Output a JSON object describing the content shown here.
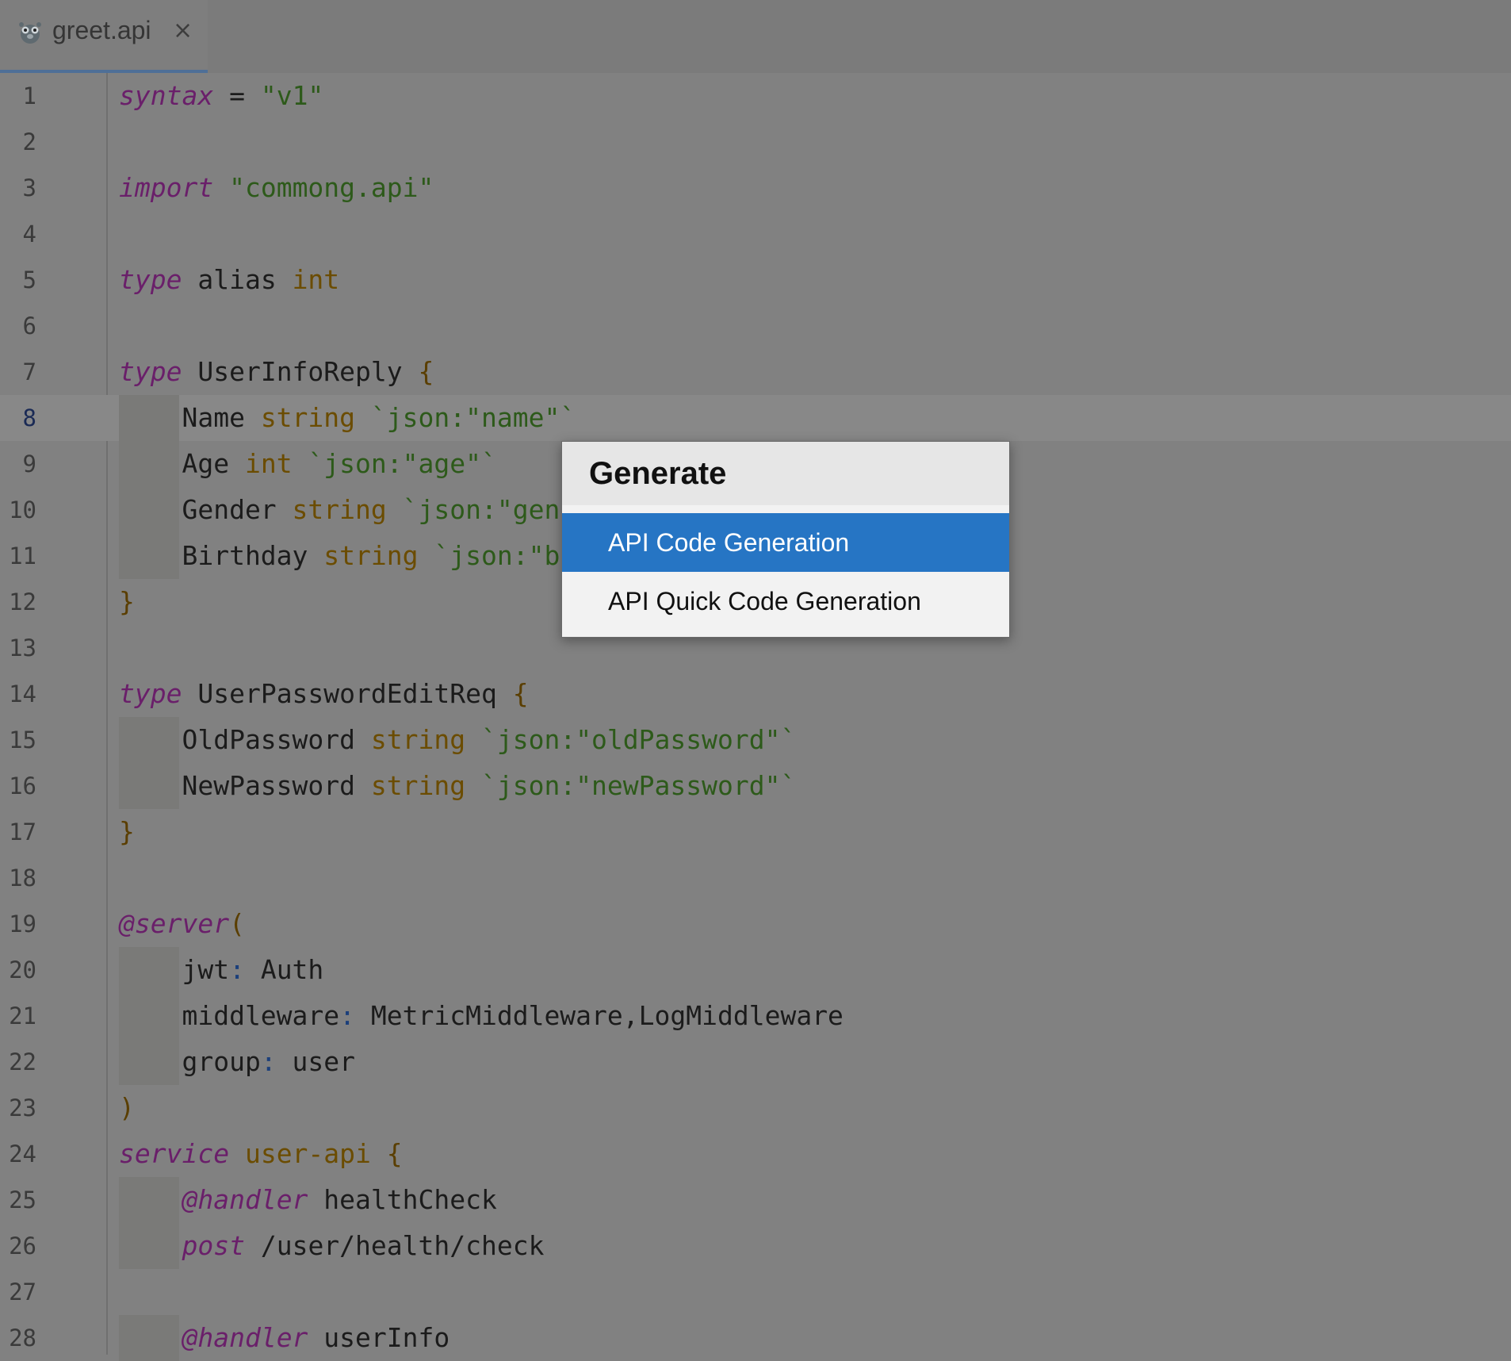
{
  "tab": {
    "file_name": "greet.api",
    "close_glyph": "×",
    "icon": "gopher-icon"
  },
  "editor": {
    "current_line": "8",
    "lines": [
      {
        "n": "1",
        "segs": [
          [
            "kw",
            "syntax"
          ],
          [
            "p",
            " = "
          ],
          [
            "str",
            "\"v1\""
          ]
        ]
      },
      {
        "n": "2",
        "segs": []
      },
      {
        "n": "3",
        "segs": [
          [
            "kw",
            "import"
          ],
          [
            "p",
            " "
          ],
          [
            "str",
            "\"commong.api\""
          ]
        ]
      },
      {
        "n": "4",
        "segs": []
      },
      {
        "n": "5",
        "segs": [
          [
            "kw",
            "type"
          ],
          [
            "p",
            " alias "
          ],
          [
            "ty",
            "int"
          ]
        ]
      },
      {
        "n": "6",
        "segs": []
      },
      {
        "n": "7",
        "segs": [
          [
            "kw",
            "type"
          ],
          [
            "p",
            " UserInfoReply "
          ],
          [
            "brace",
            "{"
          ]
        ]
      },
      {
        "n": "8",
        "indent": true,
        "segs": [
          [
            "p",
            "    Name "
          ],
          [
            "ty",
            "string"
          ],
          [
            "p",
            " "
          ],
          [
            "str",
            "`json:\"name\"`"
          ]
        ]
      },
      {
        "n": "9",
        "indent": true,
        "segs": [
          [
            "p",
            "    Age "
          ],
          [
            "ty",
            "int"
          ],
          [
            "p",
            " "
          ],
          [
            "str",
            "`json:\"age\"`"
          ]
        ]
      },
      {
        "n": "10",
        "indent": true,
        "segs": [
          [
            "p",
            "    Gender "
          ],
          [
            "ty",
            "string"
          ],
          [
            "p",
            " "
          ],
          [
            "str",
            "`json:\"gend"
          ]
        ]
      },
      {
        "n": "11",
        "indent": true,
        "segs": [
          [
            "p",
            "    Birthday "
          ],
          [
            "ty",
            "string"
          ],
          [
            "p",
            " "
          ],
          [
            "str",
            "`json:\"bi"
          ]
        ]
      },
      {
        "n": "12",
        "segs": [
          [
            "brace",
            "}"
          ]
        ]
      },
      {
        "n": "13",
        "segs": []
      },
      {
        "n": "14",
        "segs": [
          [
            "kw",
            "type"
          ],
          [
            "p",
            " UserPasswordEditReq "
          ],
          [
            "brace",
            "{"
          ]
        ]
      },
      {
        "n": "15",
        "indent": true,
        "segs": [
          [
            "p",
            "    OldPassword "
          ],
          [
            "ty",
            "string"
          ],
          [
            "p",
            " "
          ],
          [
            "str",
            "`json:\"oldPassword\"`"
          ]
        ]
      },
      {
        "n": "16",
        "indent": true,
        "segs": [
          [
            "p",
            "    NewPassword "
          ],
          [
            "ty",
            "string"
          ],
          [
            "p",
            " "
          ],
          [
            "str",
            "`json:\"newPassword\"`"
          ]
        ]
      },
      {
        "n": "17",
        "segs": [
          [
            "brace",
            "}"
          ]
        ]
      },
      {
        "n": "18",
        "segs": []
      },
      {
        "n": "19",
        "segs": [
          [
            "kw",
            "@server"
          ],
          [
            "brace",
            "("
          ]
        ]
      },
      {
        "n": "20",
        "indent": true,
        "segs": [
          [
            "p",
            "    jwt"
          ],
          [
            "colon",
            ":"
          ],
          [
            "p",
            " Auth"
          ]
        ]
      },
      {
        "n": "21",
        "indent": true,
        "segs": [
          [
            "p",
            "    middleware"
          ],
          [
            "colon",
            ":"
          ],
          [
            "p",
            " MetricMiddleware,LogMiddleware"
          ]
        ]
      },
      {
        "n": "22",
        "indent": true,
        "segs": [
          [
            "p",
            "    group"
          ],
          [
            "colon",
            ":"
          ],
          [
            "p",
            " user"
          ]
        ]
      },
      {
        "n": "23",
        "segs": [
          [
            "brace",
            ")"
          ]
        ]
      },
      {
        "n": "24",
        "segs": [
          [
            "kw",
            "service"
          ],
          [
            "p",
            " "
          ],
          [
            "ty",
            "user-api"
          ],
          [
            "p",
            " "
          ],
          [
            "brace",
            "{"
          ]
        ]
      },
      {
        "n": "25",
        "indent": true,
        "segs": [
          [
            "p",
            "    "
          ],
          [
            "kw",
            "@handler"
          ],
          [
            "p",
            " healthCheck"
          ]
        ]
      },
      {
        "n": "26",
        "indent": true,
        "segs": [
          [
            "p",
            "    "
          ],
          [
            "kw",
            "post"
          ],
          [
            "p",
            " /user/health/check"
          ]
        ]
      },
      {
        "n": "27",
        "segs": []
      },
      {
        "n": "28",
        "indent": true,
        "segs": [
          [
            "p",
            "    "
          ],
          [
            "kw",
            "@handler"
          ],
          [
            "p",
            " userInfo"
          ]
        ]
      }
    ]
  },
  "popup": {
    "title": "Generate",
    "items": [
      {
        "label": "API Code Generation",
        "selected": true
      },
      {
        "label": "API Quick Code Generation",
        "selected": false
      }
    ]
  }
}
